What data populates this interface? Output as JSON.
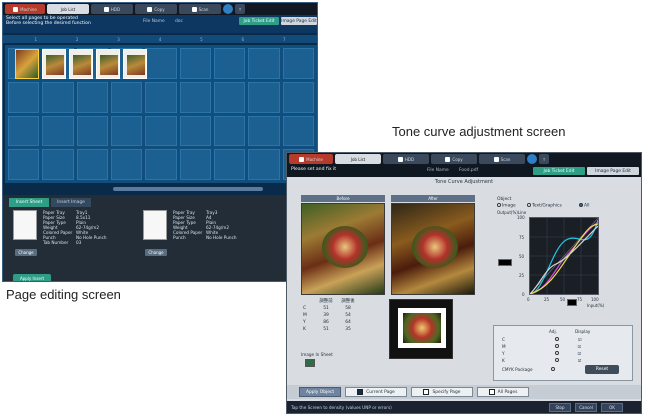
{
  "page_edit": {
    "tabs": [
      "Machine",
      "Job List",
      "HDD",
      "Copy",
      "Scan"
    ],
    "instruction": "Select all pages to be operated\nBefore selecting the desired function",
    "file_name_label": "File Name",
    "file_name": "doc",
    "job_ticket_edit": "Job Ticket Edit",
    "image_page_edit": "Image Page Edit",
    "ruler": [
      "1",
      "2",
      "3",
      "4",
      "5",
      "6",
      "7"
    ],
    "insert_tabs": [
      "Insert Sheet",
      "Insert Image"
    ],
    "paper_info_left": [
      {
        "k": "Paper Tray",
        "v": "Tray1"
      },
      {
        "k": "Paper Size",
        "v": "8.5x11"
      },
      {
        "k": "Paper Type",
        "v": "Plain"
      },
      {
        "k": "Weight",
        "v": "62-74g/m2"
      },
      {
        "k": "Colored Paper",
        "v": "White"
      },
      {
        "k": "Punch",
        "v": "No Hole Punch"
      },
      {
        "k": "Tab Number",
        "v": "03"
      }
    ],
    "paper_info_right": [
      {
        "k": "Paper Tray",
        "v": "Tray3"
      },
      {
        "k": "Paper Size",
        "v": "A4"
      },
      {
        "k": "Paper Type",
        "v": "Plain"
      },
      {
        "k": "Weight",
        "v": "62-74g/m2"
      },
      {
        "k": "Colored Paper",
        "v": "White"
      },
      {
        "k": "Punch",
        "v": "No Hole Punch"
      }
    ],
    "change_label": "Change",
    "apply_label": "Apply Insert"
  },
  "captions": {
    "tone": "Tone curve adjustment screen",
    "page": "Page editing screen"
  },
  "tone": {
    "tabs": [
      "Machine",
      "Job List",
      "HDD",
      "Copy",
      "Scan"
    ],
    "instruction": "Please set and fix it",
    "file_name_label": "File Name",
    "file_name": "Food.pdf",
    "job_ticket_edit": "Job Ticket Edit",
    "image_page_edit": "Image Page Edit",
    "title": "Tone Curve Adjustment",
    "before": "Before",
    "after": "After",
    "cmyk_headers": [
      "",
      "調整前",
      "調整後"
    ],
    "cmyk_rows": [
      {
        "ch": "C",
        "b": "51",
        "a": "58"
      },
      {
        "ch": "M",
        "b": "39",
        "a": "54"
      },
      {
        "ch": "Y",
        "b": "86",
        "a": "64"
      },
      {
        "ch": "K",
        "b": "51",
        "a": "35"
      }
    ],
    "image_in_sheet": "Image In Sheet",
    "object_label": "Object",
    "object_options": [
      "Image",
      "Text/Graphics",
      "All"
    ],
    "output_label": "Output(%)Line",
    "input_label": "Input(%)",
    "y_ticks": [
      "100",
      "75",
      "50",
      "25",
      "0"
    ],
    "x_ticks": [
      "0",
      "25",
      "50",
      "75",
      "100"
    ],
    "adj_label": "Adj.",
    "display_label": "Display",
    "channels": [
      "C",
      "M",
      "Y",
      "K"
    ],
    "cmyk_package": "CMYK Package",
    "reset": "Reset",
    "apply_to": "Apply Object",
    "current_page": "Current Page",
    "specify_page": "Specify Page",
    "all_pages": "All Pages",
    "status": "Tap the Screen to density (values UNP or errors)",
    "status_buttons": [
      "Stop",
      "Cancel",
      "OK"
    ],
    "curve_colors": {
      "c": "#26c6e6",
      "m": "#d24ae0",
      "y": "#e6e04a",
      "k": "#d8d8d8"
    }
  }
}
